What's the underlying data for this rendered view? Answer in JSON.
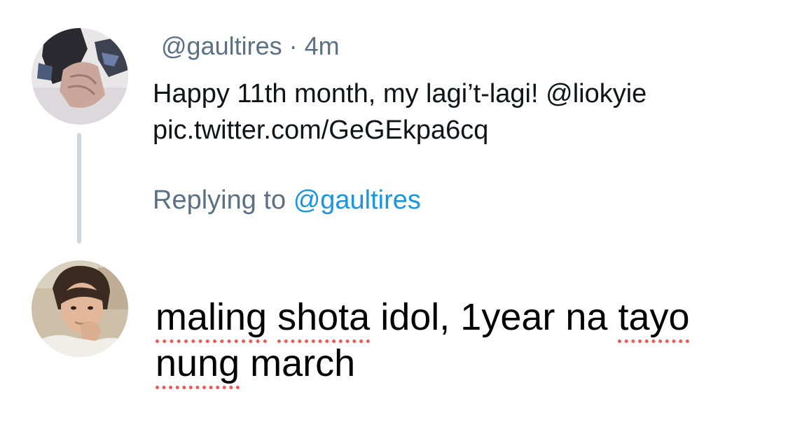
{
  "tweet": {
    "handle": "@gaultires",
    "separator": "·",
    "time": "4m",
    "text_line1": "Happy 11th month, my lagi’t-lagi! @liokyie",
    "text_line2": "pic.twitter.com/GeGEkpa6cq"
  },
  "reply_context": {
    "prefix": "Replying to",
    "handle": "@gaultires"
  },
  "compose": {
    "words": {
      "maling": "maling",
      "shota": "shota",
      "idol": "idol, 1year na",
      "tayo": "tayo",
      "nung": "nung",
      "march": "march"
    }
  },
  "colors": {
    "secondary_text": "#5b7083",
    "link_blue": "#1b95e0",
    "spellcheck_red": "#ee5a56",
    "thread_line": "#cfd6dd"
  },
  "icons": {
    "tweet_avatar": "profile-photo",
    "reply_avatar": "profile-photo"
  }
}
